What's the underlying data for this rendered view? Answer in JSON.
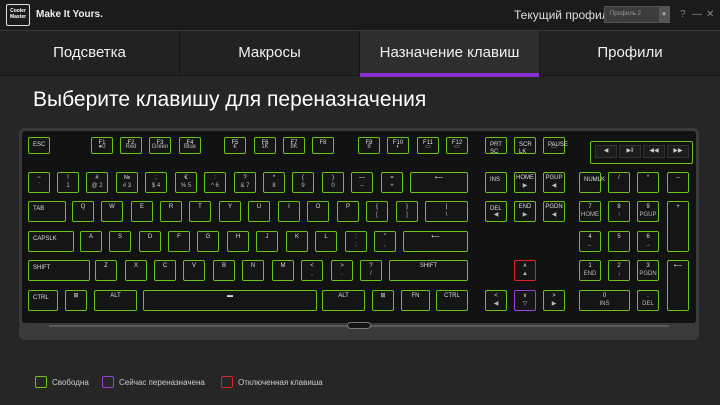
{
  "app": {
    "logo_text": "Cooler Master",
    "tagline": "Make It Yours.",
    "profile_label": "Текущий профиль",
    "profile_value": "Профиль 2",
    "help": "?",
    "minimize": "—",
    "close": "✕"
  },
  "tabs": [
    {
      "label": "Подсветка",
      "active": false
    },
    {
      "label": "Макросы",
      "active": false
    },
    {
      "label": "Назначение клавиш",
      "active": true
    },
    {
      "label": "Профили",
      "active": false
    }
  ],
  "page_title": "Выберите клавишу для переназначения",
  "keyboard": {
    "keys": [
      {
        "id": "esc",
        "l1": "ESC"
      },
      {
        "id": "f1",
        "l1": "F1",
        "l2": "●0"
      },
      {
        "id": "f2",
        "l1": "F2",
        "l2": "Red"
      },
      {
        "id": "f3",
        "l1": "F3",
        "l2": "Green"
      },
      {
        "id": "f4",
        "l1": "F4",
        "l2": "Blue"
      },
      {
        "id": "f5",
        "l1": "F5",
        "l2": "€"
      },
      {
        "id": "f6",
        "l1": "F6",
        "l2": "1K"
      },
      {
        "id": "f7",
        "l1": "F7",
        "l2": "8K"
      },
      {
        "id": "f8",
        "l1": "F8",
        "l2": ""
      },
      {
        "id": "f9",
        "l1": "F9",
        "l2": "8"
      },
      {
        "id": "f10",
        "l1": "F10",
        "l2": "◐"
      },
      {
        "id": "f11",
        "l1": "F11",
        "l2": "▭"
      },
      {
        "id": "f12",
        "l1": "F12",
        "l2": "▭"
      },
      {
        "id": "prtsc",
        "l1": "PRT SC"
      },
      {
        "id": "scrlk",
        "l1": "SCR LK"
      },
      {
        "id": "pause",
        "l1": "PAUSE",
        "l2": "▭"
      },
      {
        "id": "tilde",
        "l1": "~",
        "l2": "`"
      },
      {
        "id": "k1",
        "l1": "!",
        "l2": "1"
      },
      {
        "id": "k2",
        "l1": "#",
        "l2": "@ 2"
      },
      {
        "id": "k3",
        "l1": "№",
        "l2": "# 3"
      },
      {
        "id": "k4",
        "l1": ";",
        "l2": "$ 4"
      },
      {
        "id": "k5",
        "l1": "€",
        "l2": "% 5"
      },
      {
        "id": "k6",
        "l1": ":",
        "l2": "^ 6"
      },
      {
        "id": "k7",
        "l1": "?",
        "l2": "& 7"
      },
      {
        "id": "k8",
        "l1": "*",
        "l2": "8"
      },
      {
        "id": "k9",
        "l1": "(",
        "l2": "9"
      },
      {
        "id": "k0",
        "l1": ")",
        "l2": "0"
      },
      {
        "id": "minus",
        "l1": "—",
        "l2": "–"
      },
      {
        "id": "plus",
        "l1": "=",
        "l2": "+"
      },
      {
        "id": "backspace",
        "l1": "⟵"
      },
      {
        "id": "ins",
        "l1": "INS"
      },
      {
        "id": "home",
        "l1": "HOME",
        "l2": "▶"
      },
      {
        "id": "pgup",
        "l1": "PGUP",
        "l2": "◀"
      },
      {
        "id": "numlk",
        "l1": "NUMLK"
      },
      {
        "id": "numdiv",
        "l1": "/"
      },
      {
        "id": "nummul",
        "l1": "*"
      },
      {
        "id": "numminus",
        "l1": "–"
      },
      {
        "id": "tab",
        "l1": "TAB"
      },
      {
        "id": "q",
        "l1": "Q"
      },
      {
        "id": "w",
        "l1": "W"
      },
      {
        "id": "e",
        "l1": "E"
      },
      {
        "id": "r",
        "l1": "R"
      },
      {
        "id": "t",
        "l1": "T"
      },
      {
        "id": "y",
        "l1": "Y"
      },
      {
        "id": "u",
        "l1": "U"
      },
      {
        "id": "i",
        "l1": "I"
      },
      {
        "id": "o",
        "l1": "O"
      },
      {
        "id": "p",
        "l1": "P"
      },
      {
        "id": "lbr",
        "l1": "{",
        "l2": "["
      },
      {
        "id": "rbr",
        "l1": "}",
        "l2": "]"
      },
      {
        "id": "bslash",
        "l1": "|",
        "l2": "\\"
      },
      {
        "id": "del",
        "l1": "DEL",
        "l2": "◀"
      },
      {
        "id": "end",
        "l1": "END",
        "l2": "▶"
      },
      {
        "id": "pgdn",
        "l1": "PGDN",
        "l2": "◀"
      },
      {
        "id": "num7",
        "l1": "7",
        "l2": "HOME"
      },
      {
        "id": "num8",
        "l1": "8",
        "l2": "↑"
      },
      {
        "id": "num9",
        "l1": "9",
        "l2": "PGUP"
      },
      {
        "id": "numplus",
        "l1": "+"
      },
      {
        "id": "caps",
        "l1": "CAPSLK"
      },
      {
        "id": "a",
        "l1": "A"
      },
      {
        "id": "s",
        "l1": "S"
      },
      {
        "id": "d",
        "l1": "D"
      },
      {
        "id": "f",
        "l1": "F"
      },
      {
        "id": "g",
        "l1": "G"
      },
      {
        "id": "h",
        "l1": "H"
      },
      {
        "id": "j",
        "l1": "J"
      },
      {
        "id": "k",
        "l1": "K"
      },
      {
        "id": "l",
        "l1": "L"
      },
      {
        "id": "semi",
        "l1": ":",
        "l2": ";"
      },
      {
        "id": "quote",
        "l1": "\"",
        "l2": ","
      },
      {
        "id": "enter",
        "l1": "⟵"
      },
      {
        "id": "num4",
        "l1": "4",
        "l2": "←"
      },
      {
        "id": "num5",
        "l1": "5"
      },
      {
        "id": "num6",
        "l1": "6",
        "l2": "→"
      },
      {
        "id": "lshift",
        "l1": "SHIFT"
      },
      {
        "id": "z",
        "l1": "Z"
      },
      {
        "id": "x",
        "l1": "X"
      },
      {
        "id": "c",
        "l1": "C"
      },
      {
        "id": "v",
        "l1": "V"
      },
      {
        "id": "b",
        "l1": "B"
      },
      {
        "id": "n",
        "l1": "N"
      },
      {
        "id": "m",
        "l1": "M"
      },
      {
        "id": "comma",
        "l1": "<",
        "l2": ","
      },
      {
        "id": "period",
        "l1": ">",
        "l2": "."
      },
      {
        "id": "slash",
        "l1": "?",
        "l2": "/"
      },
      {
        "id": "rshift",
        "l1": "SHIFT"
      },
      {
        "id": "up",
        "l1": "∧",
        "l2": "▲"
      },
      {
        "id": "num1",
        "l1": "1",
        "l2": "END"
      },
      {
        "id": "num2",
        "l1": "2",
        "l2": "↓"
      },
      {
        "id": "num3",
        "l1": "3",
        "l2": "PGDN"
      },
      {
        "id": "numenter",
        "l1": "⟵"
      },
      {
        "id": "lctrl",
        "l1": "CTRL"
      },
      {
        "id": "lwin",
        "l1": "⊞"
      },
      {
        "id": "lalt",
        "l1": "ALT"
      },
      {
        "id": "space",
        "l1": "▬"
      },
      {
        "id": "ralt",
        "l1": "ALT"
      },
      {
        "id": "rwin",
        "l1": "⊞"
      },
      {
        "id": "fn",
        "l1": "FN"
      },
      {
        "id": "rctrl",
        "l1": "CTRL"
      },
      {
        "id": "left",
        "l1": "<",
        "l2": "◀"
      },
      {
        "id": "down",
        "l1": "∨",
        "l2": "▽"
      },
      {
        "id": "right",
        "l1": ">",
        "l2": "▶"
      },
      {
        "id": "num0",
        "l1": "0",
        "l2": "INS"
      },
      {
        "id": "numdot",
        "l1": ".",
        "l2": "DEL"
      }
    ],
    "media": [
      "◀",
      "▶‖",
      "◀◀",
      "▶▶"
    ]
  },
  "legend": [
    {
      "label": "Свободна",
      "color": "#69c319"
    },
    {
      "label": "Сейчас переназначена",
      "color": "#9b40d9"
    },
    {
      "label": "Отключенная клавиша",
      "color": "#e0212a"
    }
  ],
  "colors": {
    "free": "#69c319",
    "remapped": "#9b40d9",
    "disabled": "#e0212a",
    "tab_accent": "#8c2fd1"
  }
}
